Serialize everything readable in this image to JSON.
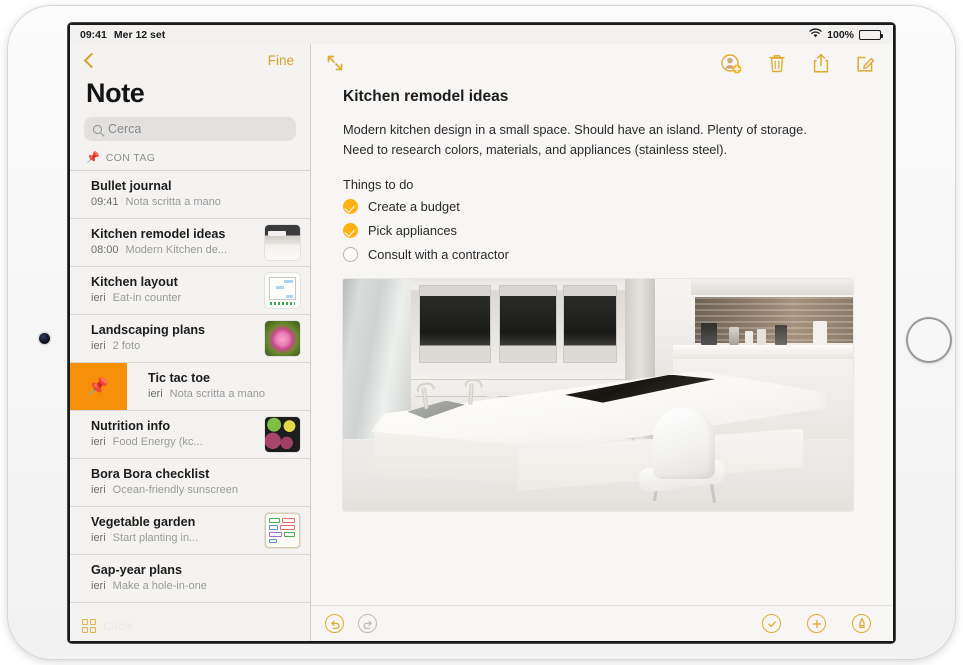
{
  "status_bar": {
    "time": "09:41",
    "date": "Mer 12 set",
    "wifi_icon": "wifi-icon",
    "battery_percent": "100%",
    "battery_icon": "battery-full-icon"
  },
  "sidebar": {
    "back_icon": "chevron-left-icon",
    "done_label": "Fine",
    "title": "Note",
    "search": {
      "icon": "search-icon",
      "placeholder": "Cerca",
      "value": ""
    },
    "section_header": {
      "icon": "pin-icon",
      "label": "CON TAG"
    },
    "footer": {
      "icon": "grid-view-icon",
      "label": "Circle"
    },
    "notes": [
      {
        "title": "Bullet journal",
        "time": "09:41",
        "snippet": "Nota scritta a mano",
        "thumb": "none",
        "selected": false,
        "swiped": false
      },
      {
        "title": "Kitchen remodel ideas",
        "time": "08:00",
        "snippet": "Modern Kitchen de...",
        "thumb": "kitchen-photo",
        "selected": true,
        "swiped": false
      },
      {
        "title": "Kitchen layout",
        "time": "ieri",
        "snippet": "Eat-in counter",
        "thumb": "floorplan-sketch",
        "selected": false,
        "swiped": false
      },
      {
        "title": "Landscaping plans",
        "time": "ieri",
        "snippet": "2 foto",
        "thumb": "flower-photo",
        "selected": false,
        "swiped": false
      },
      {
        "title": "Tic tac toe",
        "time": "ieri",
        "snippet": "Nota scritta a mano",
        "thumb": "none",
        "selected": false,
        "swiped": true,
        "swipe_action_icon": "pin-icon"
      },
      {
        "title": "Nutrition info",
        "time": "ieri",
        "snippet": "Food Energy (kc...",
        "thumb": "food-photo",
        "selected": false,
        "swiped": false
      },
      {
        "title": "Bora Bora checklist",
        "time": "ieri",
        "snippet": "Ocean-friendly sunscreen",
        "thumb": "none",
        "selected": false,
        "swiped": false
      },
      {
        "title": "Vegetable garden",
        "time": "ieri",
        "snippet": "Start planting in...",
        "thumb": "garden-plan",
        "selected": false,
        "swiped": false
      },
      {
        "title": "Gap-year plans",
        "time": "ieri",
        "snippet": "Make a hole-in-one",
        "thumb": "none",
        "selected": false,
        "swiped": false
      }
    ]
  },
  "detail": {
    "toolbar": {
      "expand_icon": "expand-arrows-icon",
      "add_person_icon": "add-collaborator-icon",
      "delete_icon": "trash-icon",
      "share_icon": "share-icon",
      "compose_icon": "compose-icon"
    },
    "note": {
      "title": "Kitchen remodel ideas",
      "paragraph_1": "Modern kitchen design in a small space. Should have an island. Plenty of storage.",
      "paragraph_2": "Need to research colors, materials, and appliances (stainless steel).",
      "checklist_label": "Things to do",
      "checklist": [
        {
          "label": "Create a budget",
          "checked": true
        },
        {
          "label": "Pick appliances",
          "checked": true
        },
        {
          "label": "Consult with a contractor",
          "checked": false
        }
      ],
      "photo_alt": "Modern white kitchen with island and black cooktop"
    },
    "footer": {
      "undo_icon": "undo-icon",
      "redo_icon": "redo-icon",
      "checklist_icon": "checklist-icon",
      "add_icon": "plus-icon",
      "markup_icon": "markup-pen-icon"
    }
  },
  "theme": {
    "accent_orange": "#e0ab33",
    "swipe_orange": "#f59008",
    "checkbox_orange": "#fcb215",
    "screen_bg": "#f6f5f3",
    "sidebar_bg": "#f4f3f1"
  }
}
